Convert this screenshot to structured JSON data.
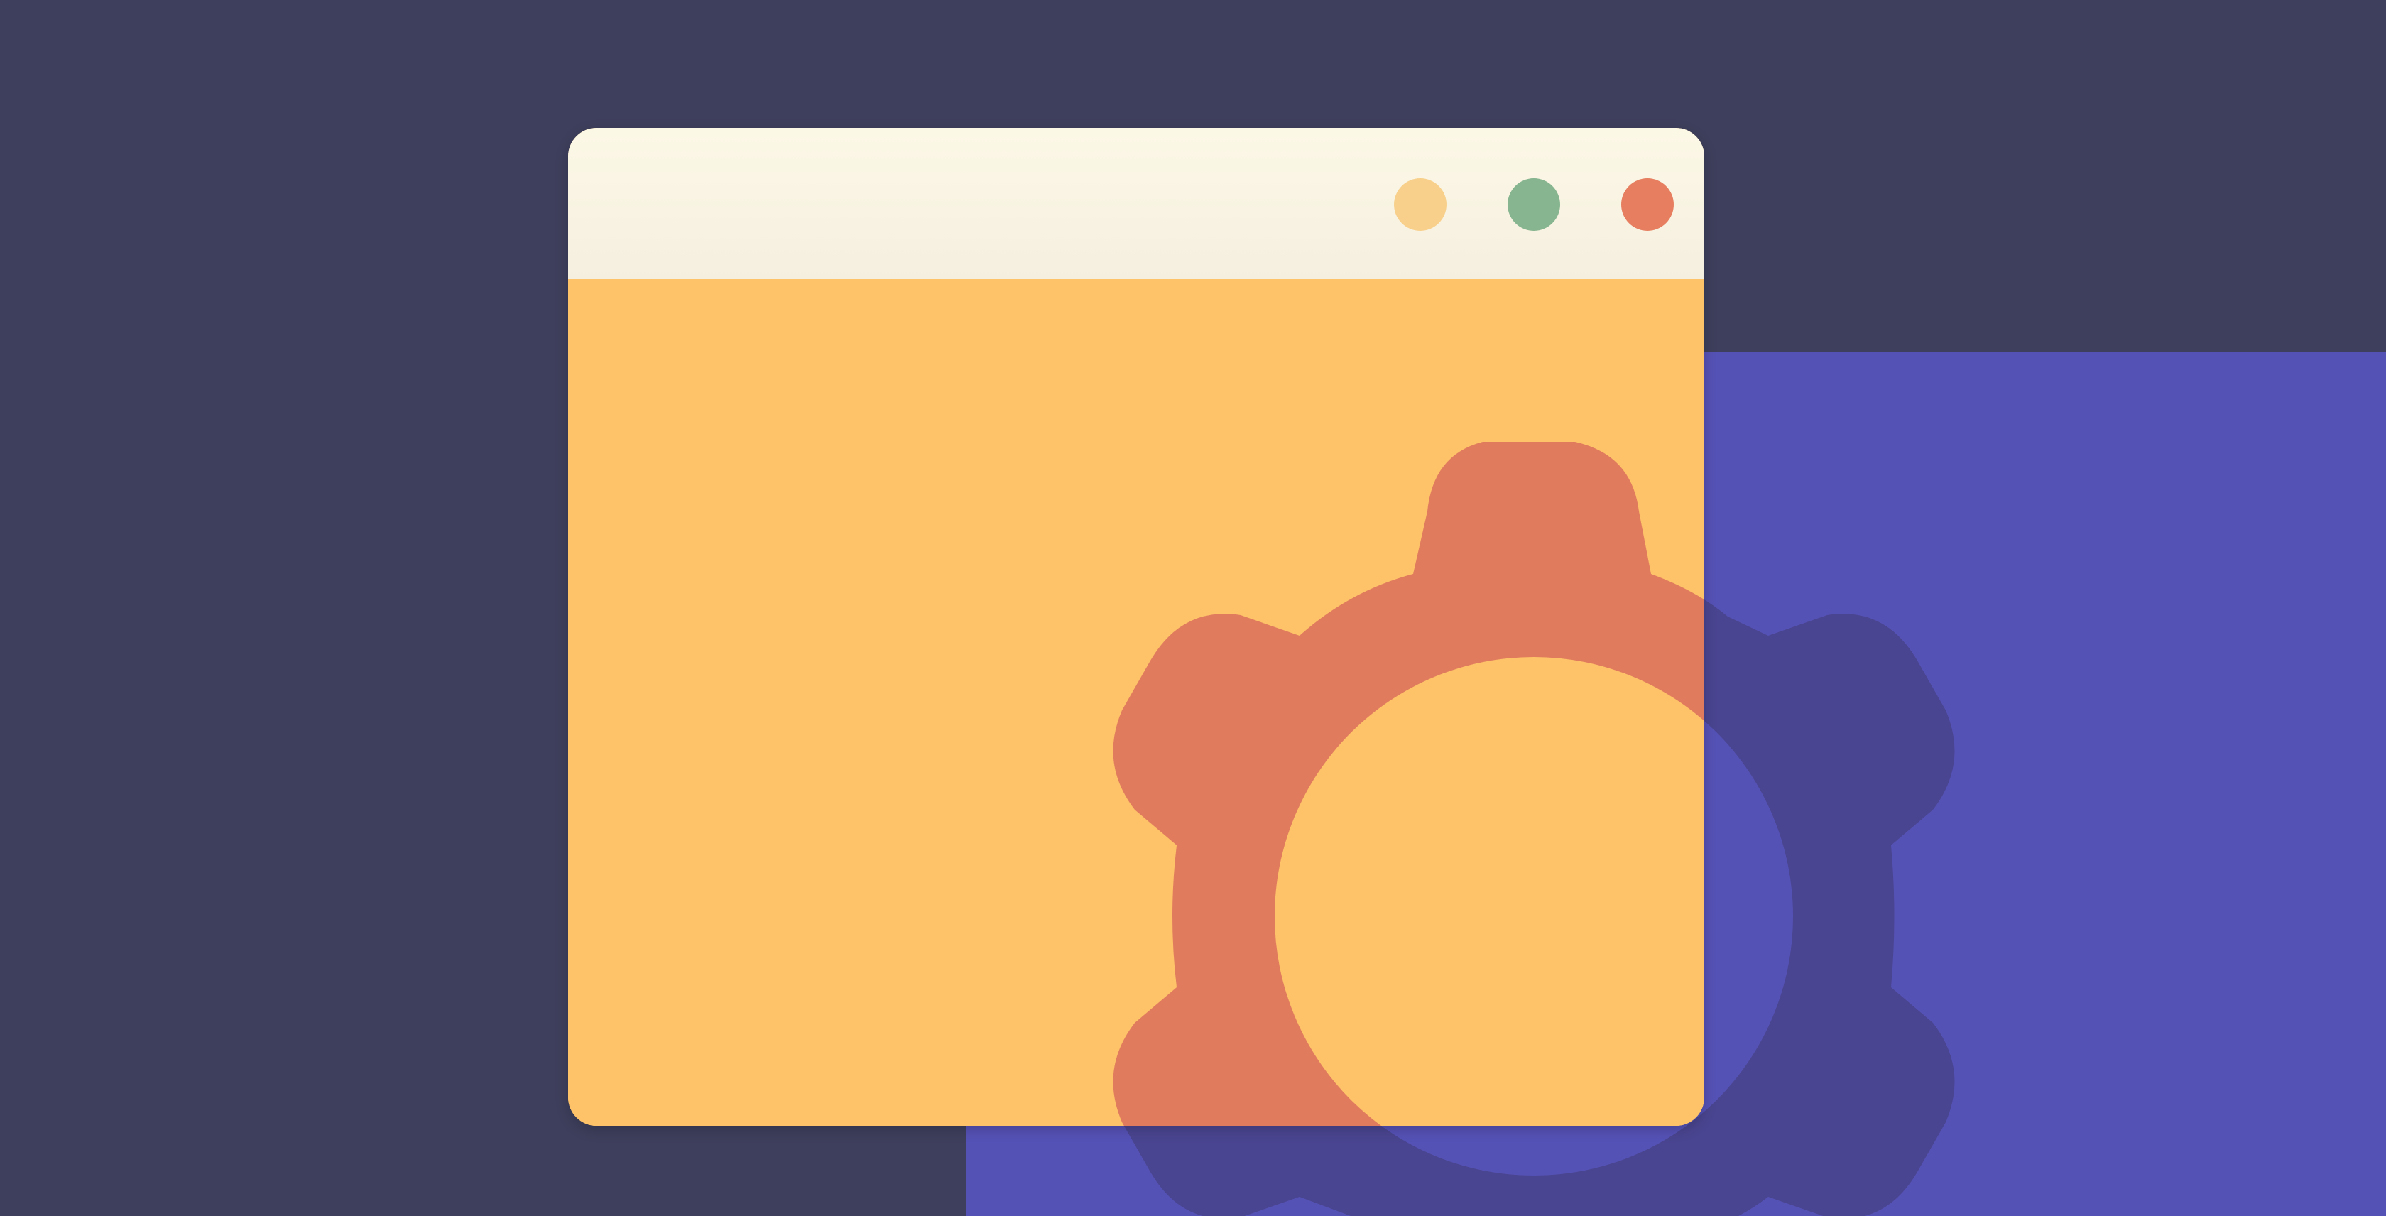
{
  "scene": {
    "kind": "settings-illustration",
    "icons": [
      "gear-icon"
    ]
  },
  "window": {
    "controls": [
      {
        "name": "minimize",
        "color": "#f8d08b"
      },
      {
        "name": "maximize",
        "color": "#86b58f"
      },
      {
        "name": "close",
        "color": "#e67e5f"
      }
    ]
  },
  "colors": {
    "background": "#3e3f5c",
    "panel": "#5552b6",
    "window_body": "#fec368",
    "titlebar": "#f8f3e3",
    "gear_on_window": "#e07b5e",
    "gear_on_panel": "#4a4590"
  }
}
